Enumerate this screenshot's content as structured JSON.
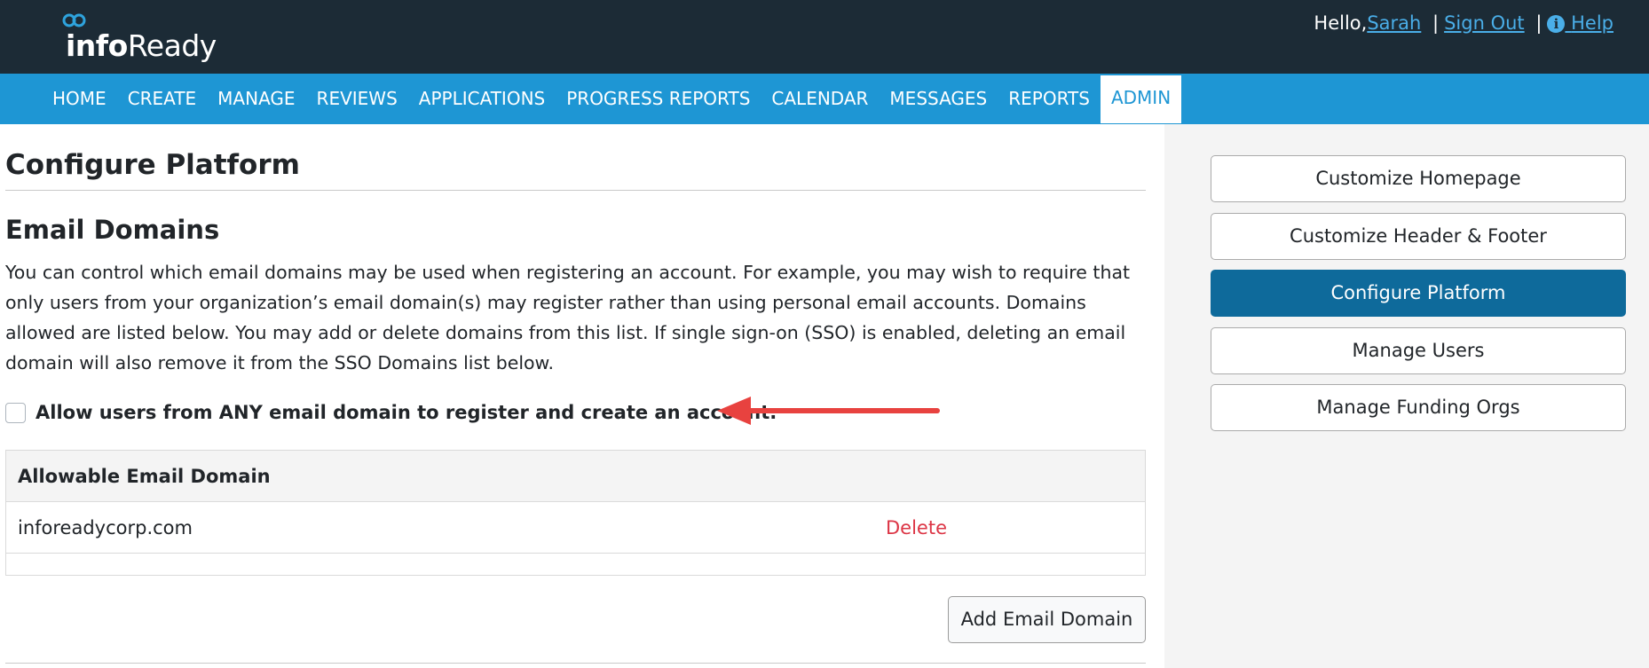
{
  "header": {
    "logo_text_bold": "info",
    "logo_text_regular": "Ready",
    "greeting": "Hello,",
    "user_name": "Sarah",
    "separator": "|",
    "sign_out": "Sign Out",
    "help": "Help",
    "help_icon": "info-circle-icon"
  },
  "nav": {
    "items": [
      "HOME",
      "CREATE",
      "MANAGE",
      "REVIEWS",
      "APPLICATIONS",
      "PROGRESS REPORTS",
      "CALENDAR",
      "MESSAGES",
      "REPORTS",
      "ADMIN"
    ],
    "active": "ADMIN"
  },
  "main": {
    "page_title": "Configure Platform",
    "section_title": "Email Domains",
    "description": "You can control which email domains may be used when registering an account. For example, you may wish to require that only users from your organization’s email domain(s) may register rather than using personal email accounts. Domains allowed are listed below. You may add or delete domains from this list. If single sign-on (SSO) is enabled, deleting an email domain will also remove it from the SSO Domains list below.",
    "allow_any_label": "Allow users from ANY email domain to register and create an account.",
    "allow_any_checked": false,
    "table": {
      "header": "Allowable Email Domain",
      "rows": [
        {
          "domain": "inforeadycorp.com",
          "action": "Delete"
        }
      ]
    },
    "add_button": "Add Email Domain"
  },
  "sidebar": {
    "buttons": [
      "Customize Homepage",
      "Customize Header & Footer",
      "Configure Platform",
      "Manage Users",
      "Manage Funding Orgs"
    ],
    "active": "Configure Platform"
  },
  "colors": {
    "topbar": "#1c2b36",
    "navbar": "#1e96d4",
    "active_sidebar": "#0e6a9b",
    "delete": "#dc3545",
    "annotation_arrow": "#e8423f"
  }
}
